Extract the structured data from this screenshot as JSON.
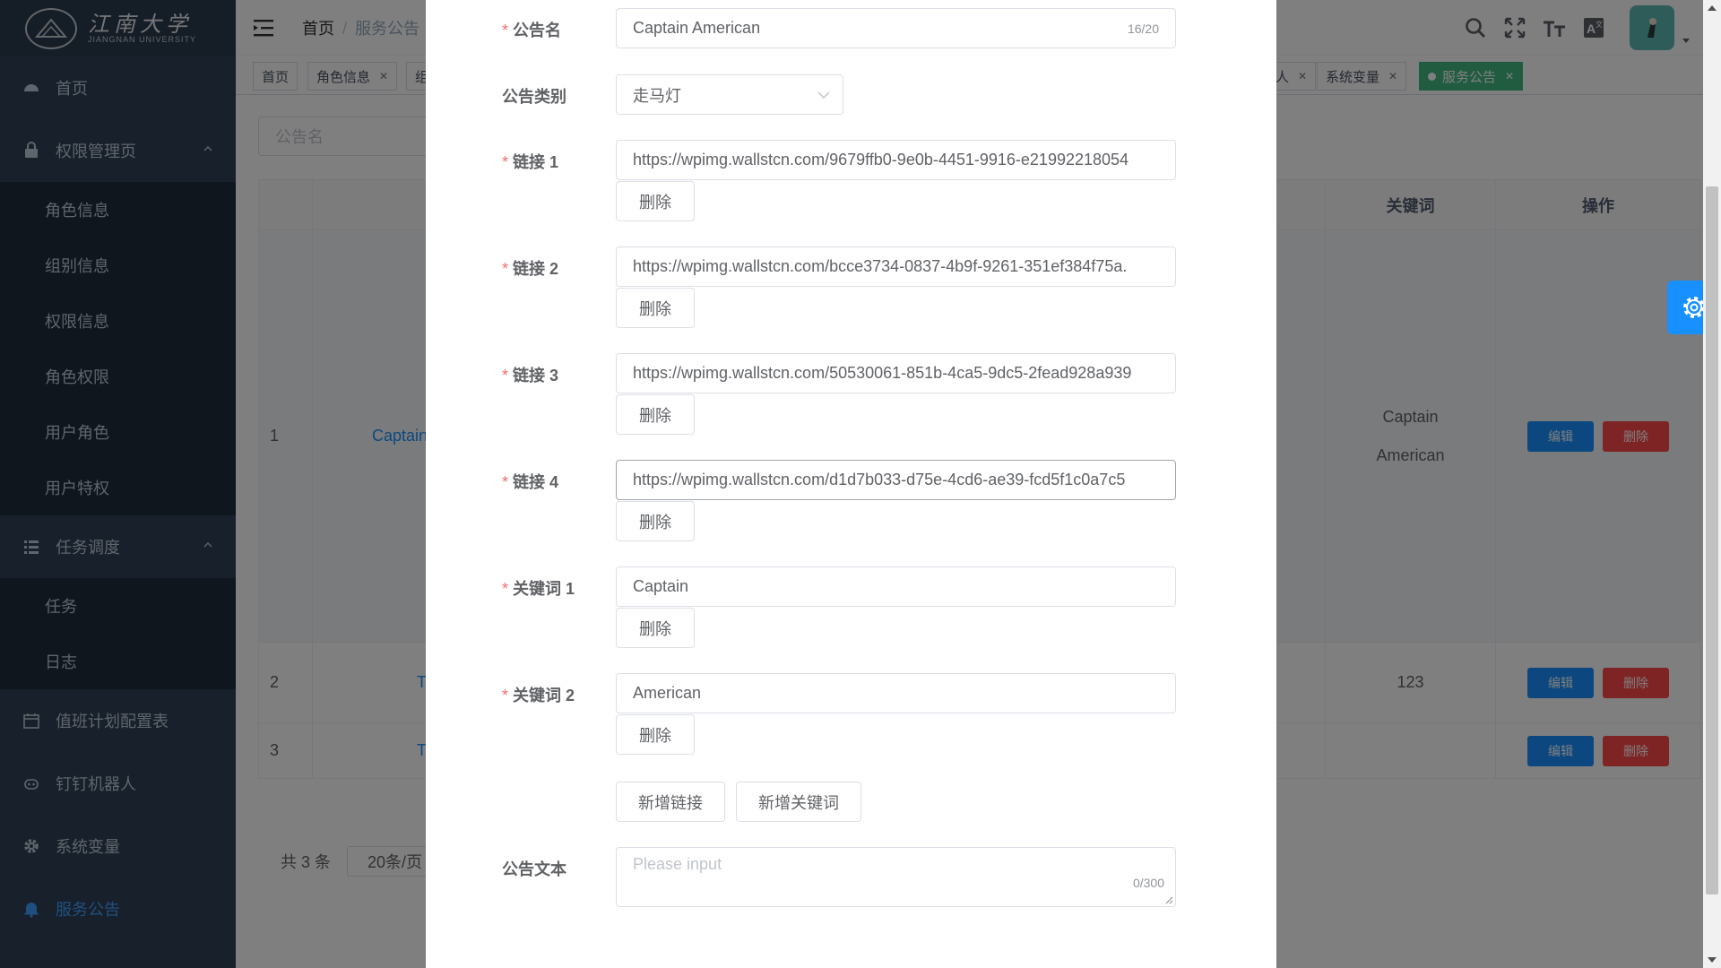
{
  "sidebar": {
    "logo_cn": "江南大学",
    "logo_en": "JIANGNAN UNIVERSITY",
    "home": "首页",
    "perm_group": "权限管理页",
    "perm_items": [
      "角色信息",
      "组别信息",
      "权限信息",
      "角色权限",
      "用户角色",
      "用户特权"
    ],
    "task_group": "任务调度",
    "task_items": [
      "任务",
      "日志"
    ],
    "duty": "值班计划配置表",
    "robot": "钉钉机器人",
    "sysvar": "系统变量",
    "notice": "服务公告"
  },
  "header": {
    "breadcrumb_home": "首页",
    "breadcrumb_current": "服务公告"
  },
  "tags": {
    "home": "首页",
    "role": "角色信息",
    "group_partial": "组",
    "right_partial": "人",
    "sysvar": "系统变量",
    "notice": "服务公告"
  },
  "page": {
    "search_placeholder": "公告名",
    "col_keywords": "关键词",
    "col_actions": "操作",
    "rows": [
      {
        "idx": "1",
        "name": "Captain",
        "kw1": "Captain",
        "kw2": "American"
      },
      {
        "idx": "2",
        "name": "T",
        "kw1": "123",
        "kw2": ""
      },
      {
        "idx": "3",
        "name": "T",
        "kw1": "",
        "kw2": ""
      }
    ],
    "edit_label": "编辑",
    "delete_label": "删除",
    "total": "共 3 条",
    "page_size": "20条/页"
  },
  "dialog": {
    "name_label": "公告名",
    "name_value": "Captain American",
    "name_count": "16/20",
    "type_label": "公告类别",
    "type_value": "走马灯",
    "links": [
      {
        "label": "链接 1",
        "value": "https://wpimg.wallstcn.com/9679ffb0-9e0b-4451-9916-e21992218054"
      },
      {
        "label": "链接 2",
        "value": "https://wpimg.wallstcn.com/bcce3734-0837-4b9f-9261-351ef384f75a."
      },
      {
        "label": "链接 3",
        "value": "https://wpimg.wallstcn.com/50530061-851b-4ca5-9dc5-2fead928a939"
      },
      {
        "label": "链接 4",
        "value": "https://wpimg.wallstcn.com/d1d7b033-d75e-4cd6-ae39-fcd5f1c0a7c5"
      }
    ],
    "keywords": [
      {
        "label": "关键词 1",
        "value": "Captain"
      },
      {
        "label": "关键词 2",
        "value": "American"
      }
    ],
    "delete_label": "删除",
    "add_link": "新增链接",
    "add_keyword": "新增关键词",
    "text_label": "公告文本",
    "text_placeholder": "Please input",
    "text_count": "0/300"
  },
  "colors": {
    "sidebar_bg": "#304156",
    "submenu_bg": "#1f2d3d",
    "active_blue": "#409eff",
    "tag_active": "#42b983",
    "required_red": "#f56c6c"
  }
}
